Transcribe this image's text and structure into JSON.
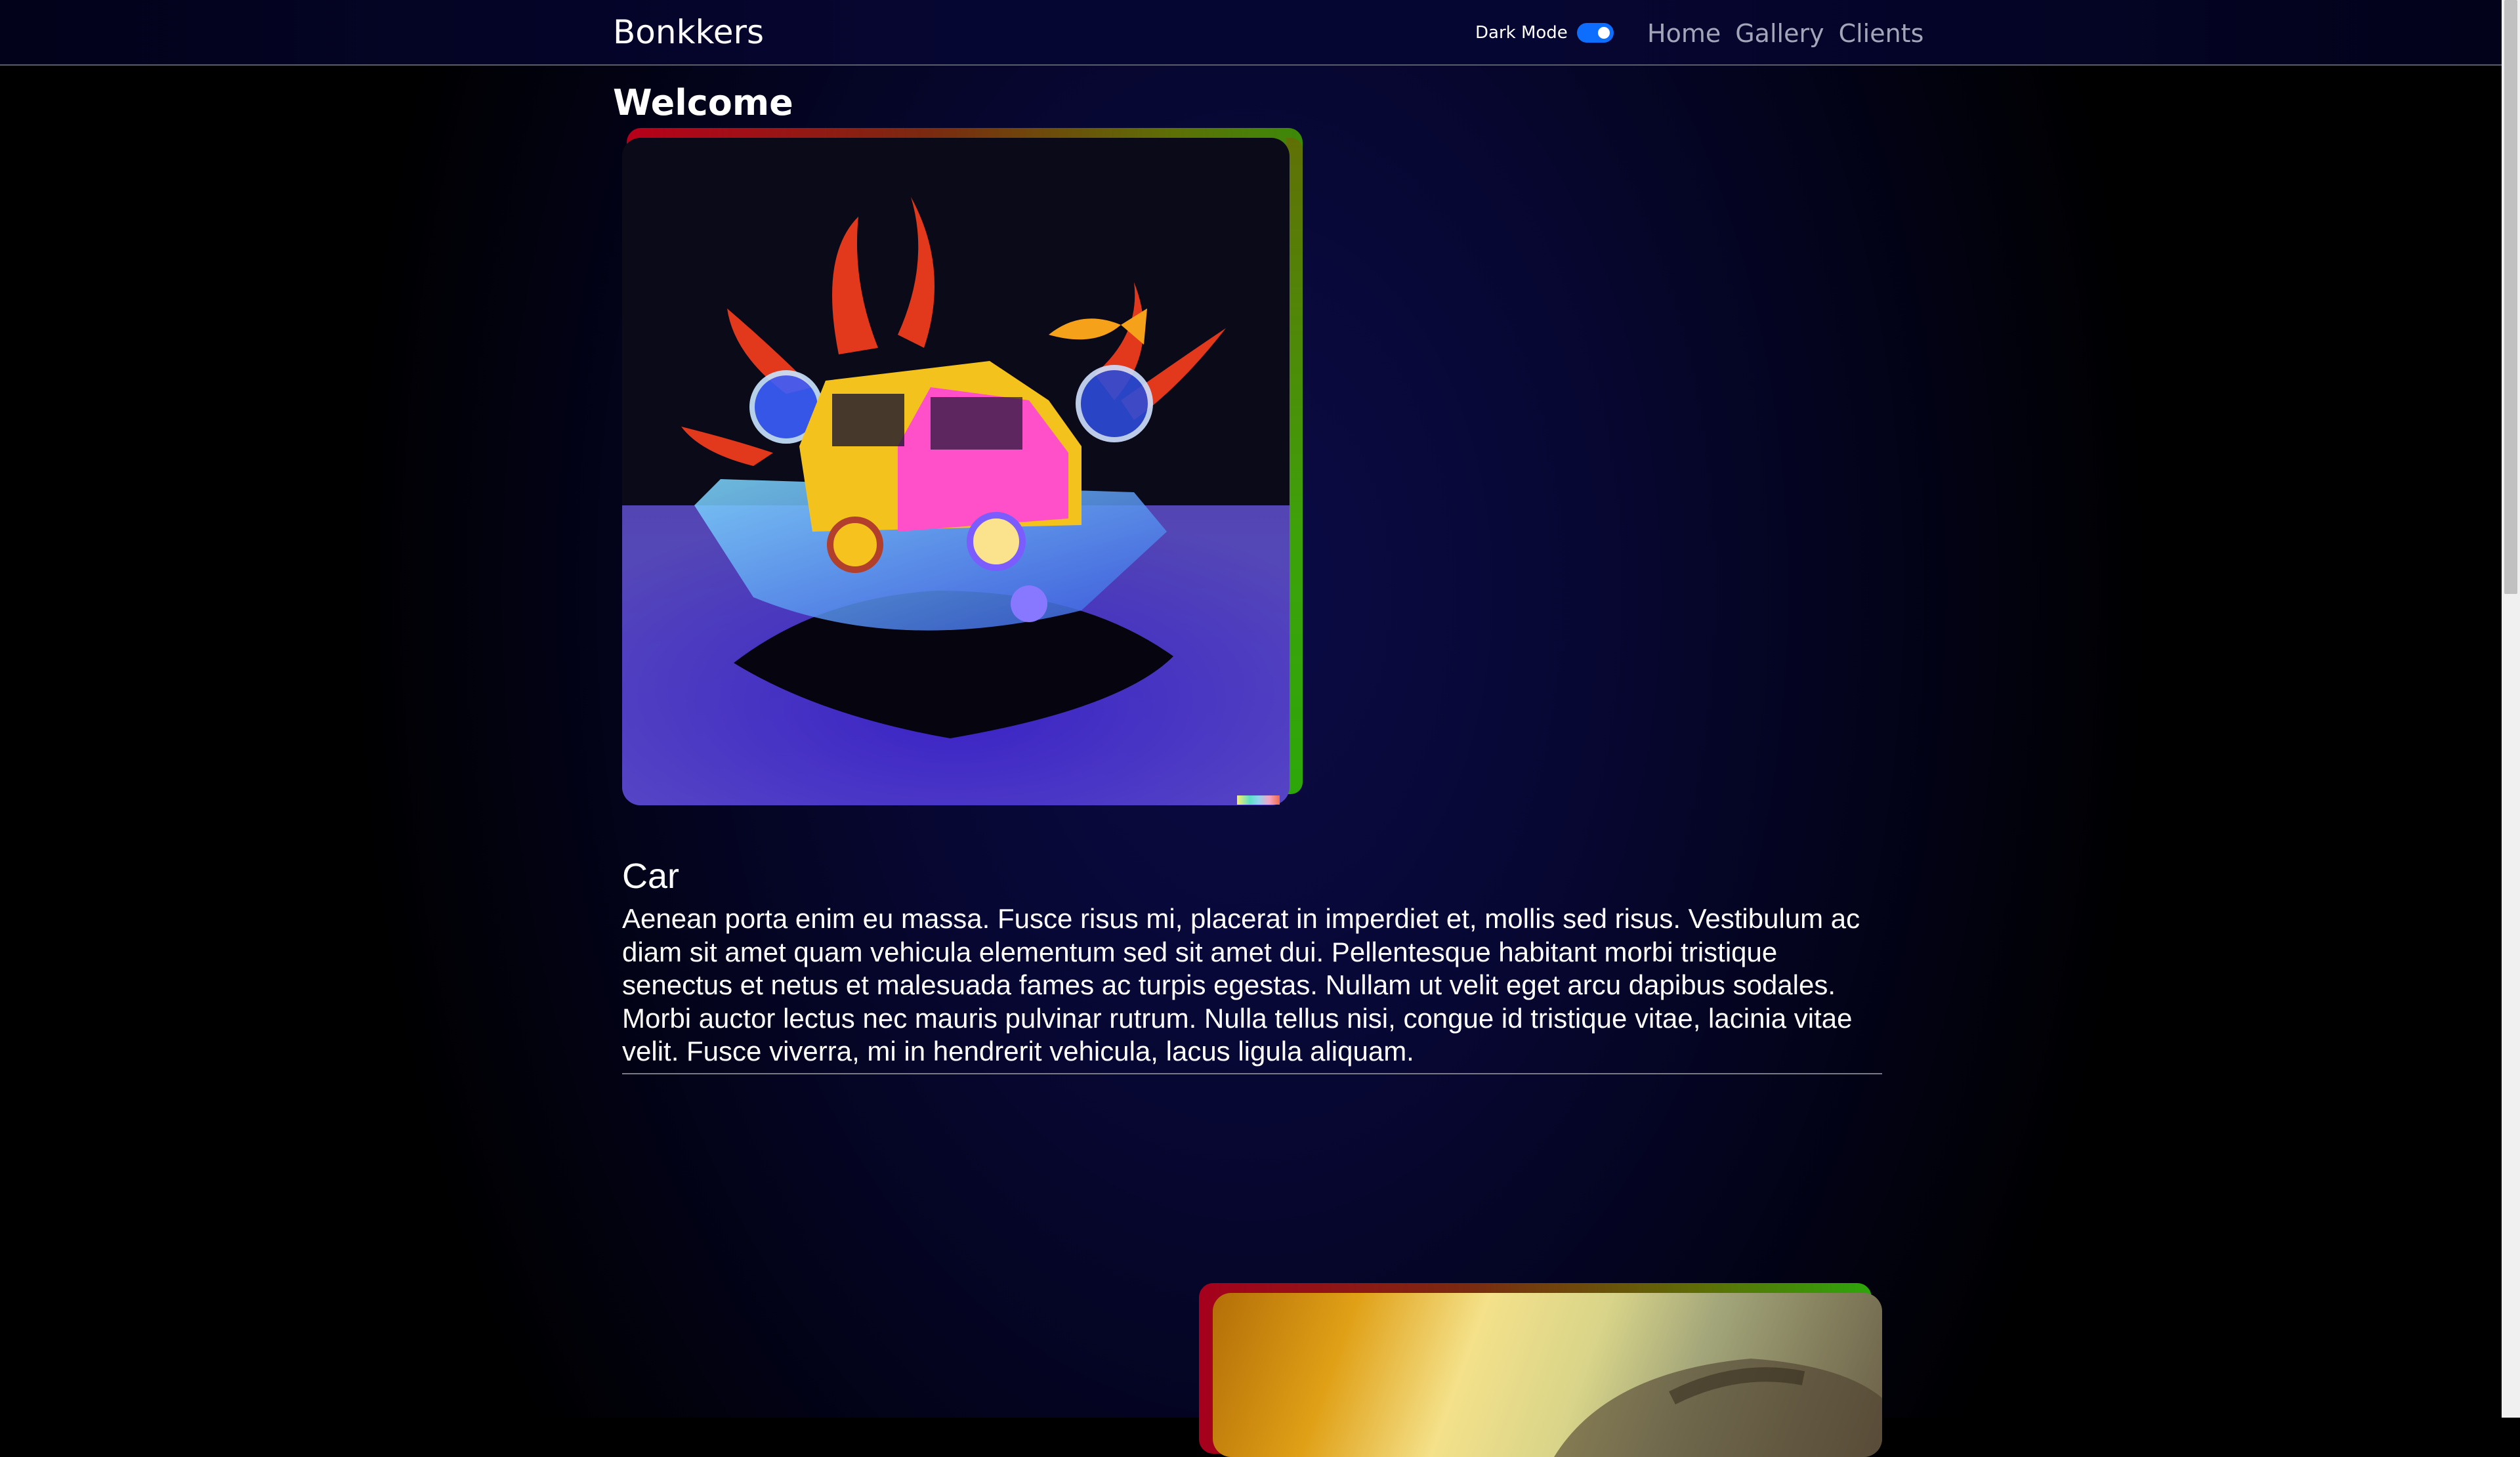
{
  "navbar": {
    "brand": "Bonkkers",
    "dark_mode_label": "Dark Mode",
    "dark_mode_on": true,
    "links": [
      "Home",
      "Gallery",
      "Clients"
    ]
  },
  "main": {
    "title": "Welcome",
    "cards": [
      {
        "title": "Car",
        "body": "Aenean porta enim eu massa. Fusce risus mi, placerat in imperdiet et, mollis sed risus. Vestibulum ac diam sit amet quam vehicula elementum sed sit amet dui. Pellentesque habitant morbi tristique senectus et netus et malesuada fames ac turpis egestas. Nullam ut velit eget arcu dapibus sodales. Morbi auctor lectus nec mauris pulvinar rutrum. Nulla tellus nisi, congue id tristique vitae, lacinia vitae velit. Fusce viverra, mi in hendrerit vehicula, lacus ligula aliquam."
      }
    ]
  },
  "colors": {
    "background": "#000000",
    "navbar_bg": "#060633",
    "toggle_accent": "#0d6efd",
    "nav_link": "#a2a6b8",
    "frame_red": "#b8001a",
    "frame_green": "#2da60a"
  }
}
